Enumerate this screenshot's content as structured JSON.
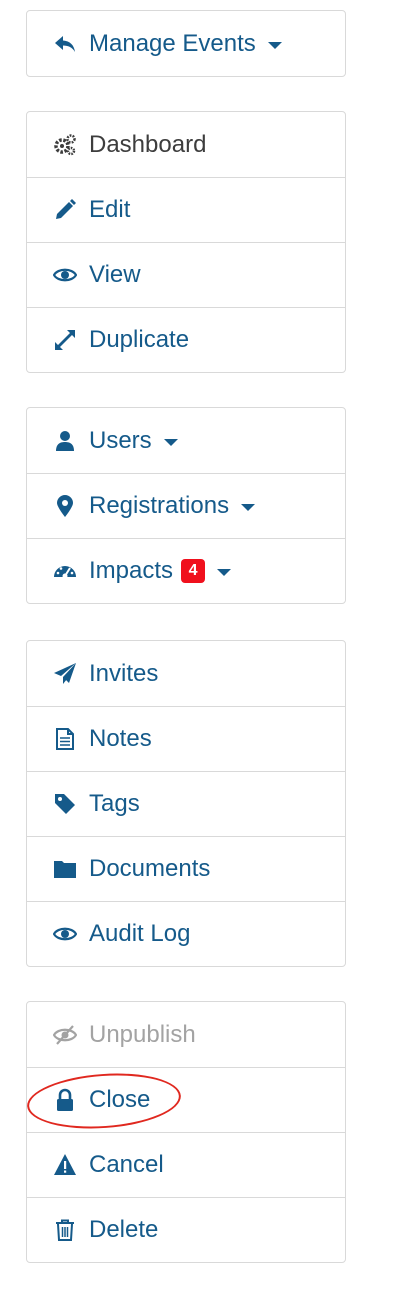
{
  "colors": {
    "link": "#155a8a",
    "text_dark": "#3d3d3d",
    "text_muted": "#a3a3a3",
    "badge": "#f0101d",
    "annotation": "#e0281f"
  },
  "manage": {
    "label": "Manage Events",
    "icon": "reply-arrow-icon"
  },
  "main_nav": [
    {
      "label": "Dashboard",
      "icon": "gears-icon"
    },
    {
      "label": "Edit",
      "icon": "pencil-icon"
    },
    {
      "label": "View",
      "icon": "eye-icon"
    },
    {
      "label": "Duplicate",
      "icon": "expand-arrows-icon"
    }
  ],
  "people_nav": [
    {
      "label": "Users",
      "icon": "user-icon"
    },
    {
      "label": "Registrations",
      "icon": "map-pin-icon"
    },
    {
      "label": "Impacts",
      "icon": "gauge-icon",
      "badge": "4"
    }
  ],
  "content_nav": [
    {
      "label": "Invites",
      "icon": "paper-plane-icon"
    },
    {
      "label": "Notes",
      "icon": "document-icon"
    },
    {
      "label": "Tags",
      "icon": "tag-icon"
    },
    {
      "label": "Documents",
      "icon": "folder-icon"
    },
    {
      "label": "Audit Log",
      "icon": "eye-icon"
    }
  ],
  "actions": [
    {
      "label": "Unpublish",
      "icon": "eye-slash-icon"
    },
    {
      "label": "Close",
      "icon": "lock-icon"
    },
    {
      "label": "Cancel",
      "icon": "warning-icon"
    },
    {
      "label": "Delete",
      "icon": "trash-icon"
    }
  ]
}
